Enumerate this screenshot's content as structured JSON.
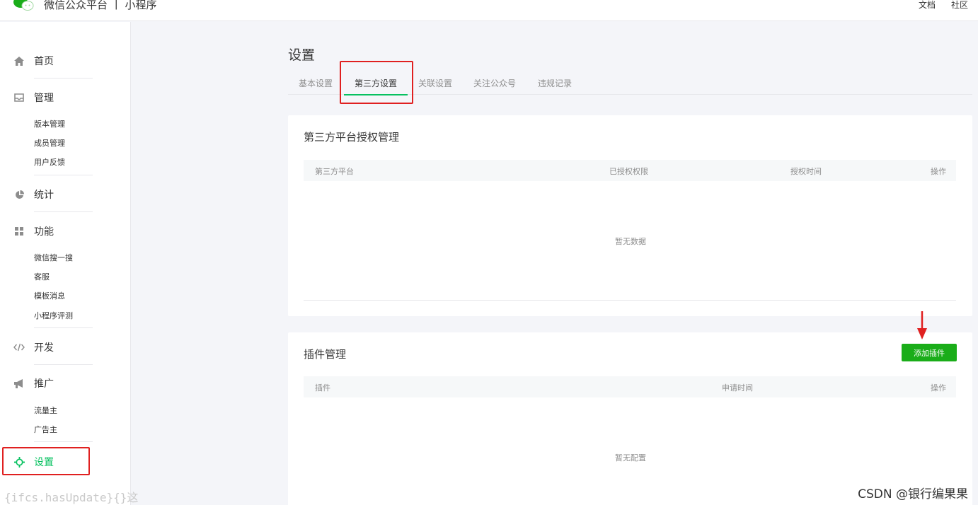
{
  "topbar": {
    "brand": "微信公众平台 丨 小程序",
    "links": [
      "文档",
      "社区"
    ]
  },
  "sidebar": {
    "sections": [
      {
        "icon": "home-icon",
        "label": "首页"
      },
      {
        "icon": "inbox-icon",
        "label": "管理",
        "items": [
          "版本管理",
          "成员管理",
          "用户反馈"
        ]
      },
      {
        "icon": "pie-chart-icon",
        "label": "统计"
      },
      {
        "icon": "grid-icon",
        "label": "功能",
        "items": [
          "微信搜一搜",
          "客服",
          "模板消息",
          "小程序评测"
        ]
      },
      {
        "icon": "code-icon",
        "label": "开发"
      },
      {
        "icon": "megaphone-icon",
        "label": "推广",
        "items": [
          "流量主",
          "广告主"
        ]
      },
      {
        "icon": "gear-icon",
        "label": "设置",
        "active": true
      }
    ]
  },
  "page": {
    "title": "设置",
    "tabs": [
      "基本设置",
      "第三方设置",
      "关联设置",
      "关注公众号",
      "违规记录"
    ],
    "active_tab": "第三方设置"
  },
  "third_party_card": {
    "title": "第三方平台授权管理",
    "columns": [
      "第三方平台",
      "已授权权限",
      "授权时间",
      "操作"
    ],
    "empty_text": "暂无数据"
  },
  "plugin_card": {
    "title": "插件管理",
    "add_button": "添加插件",
    "columns": [
      "插件",
      "申请时间",
      "操作"
    ],
    "empty_text": "暂无配置"
  },
  "overlay": {
    "code_text": "{ifcs.hasUpdate}{}这",
    "watermark": "CSDN @银行编果果"
  },
  "colors": {
    "accent": "#07c160",
    "button": "#1aad19",
    "highlight": "#e02020"
  }
}
